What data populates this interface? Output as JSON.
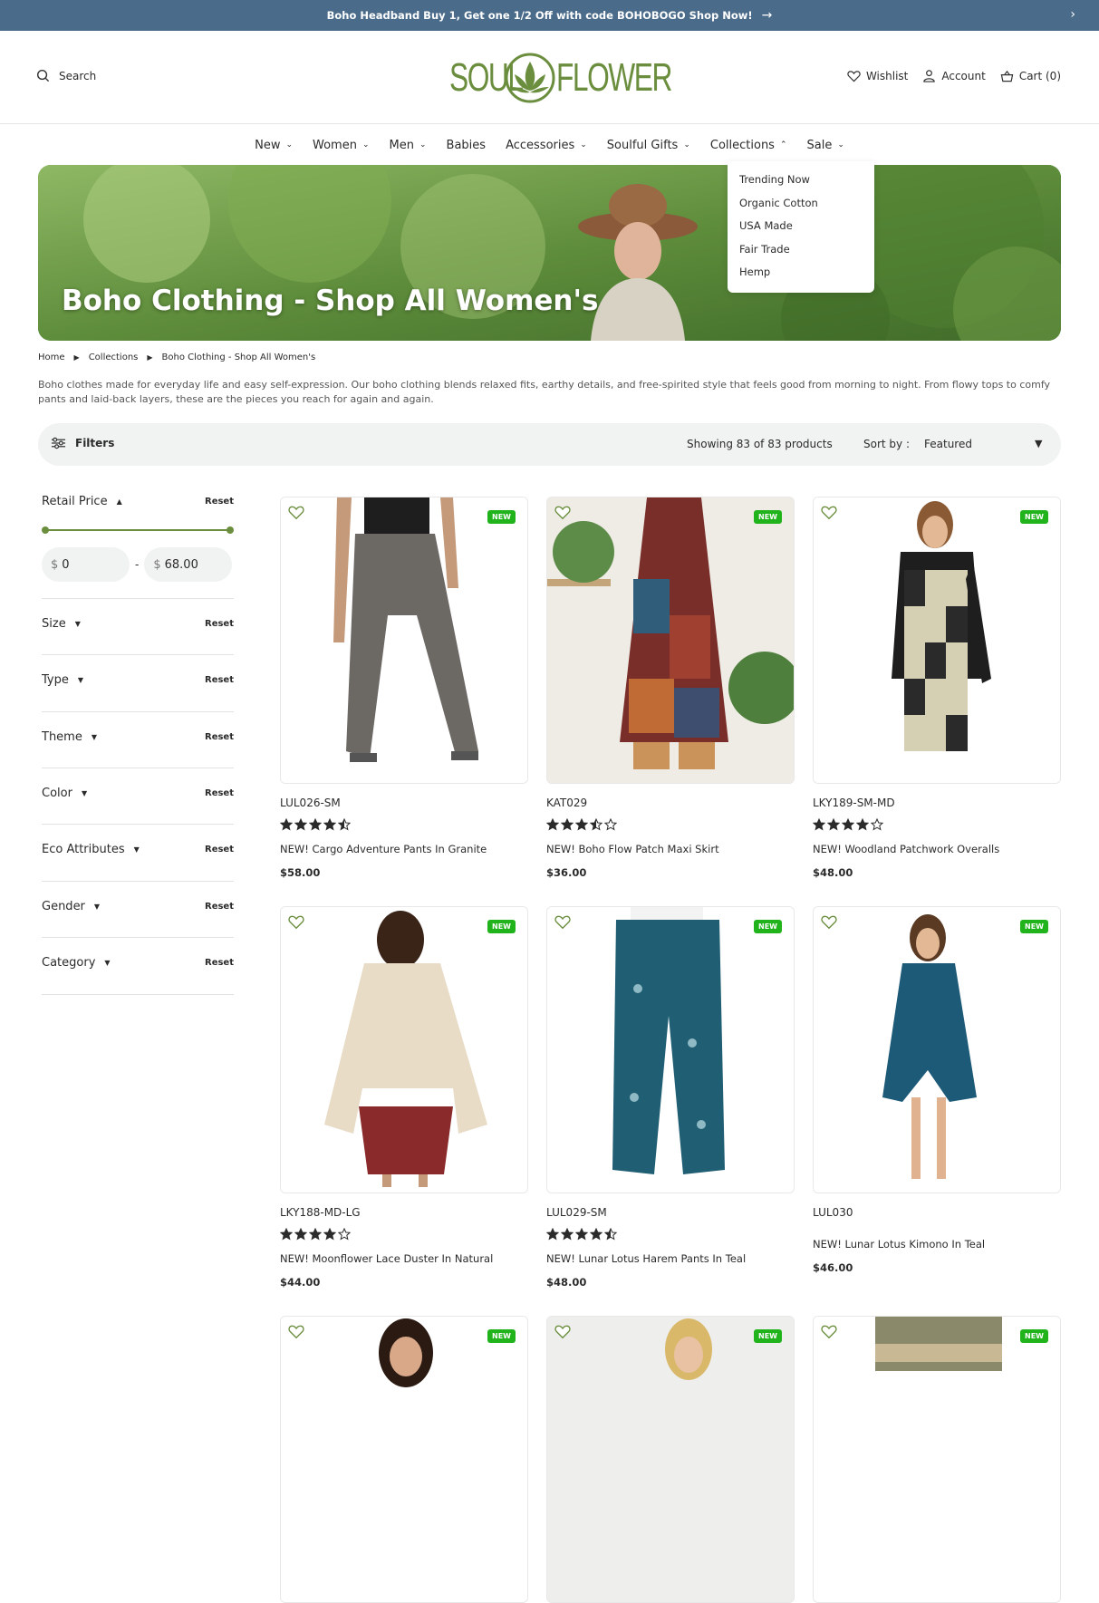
{
  "announcement": {
    "text": "Boho Headband Buy 1, Get one 1/2 Off with code BOHOBOGO  Shop Now!"
  },
  "header": {
    "search_label": "Search",
    "logo": {
      "left": "SOUL",
      "right": "FLOWER",
      "color": "#6b8e3e"
    },
    "wishlist": "Wishlist",
    "account": "Account",
    "cart": "Cart (0)"
  },
  "nav": [
    {
      "label": "New",
      "chevron": true
    },
    {
      "label": "Women",
      "chevron": true
    },
    {
      "label": "Men",
      "chevron": true
    },
    {
      "label": "Babies",
      "chevron": false
    },
    {
      "label": "Accessories",
      "chevron": true
    },
    {
      "label": "Soulful Gifts",
      "chevron": true
    },
    {
      "label": "Collections",
      "chevron": true,
      "open": true
    },
    {
      "label": "Sale",
      "chevron": true
    }
  ],
  "collections_menu": [
    "Trending Now",
    "Organic Cotton",
    "USA Made",
    "Fair Trade",
    "Hemp"
  ],
  "hero": {
    "title": "Boho Clothing - Shop All Women's"
  },
  "breadcrumb": [
    "Home",
    "Collections",
    "Boho Clothing - Shop All Women's"
  ],
  "description": "Boho clothes made for everyday life and easy self-expression. Our boho clothing blends relaxed fits, earthy details, and free-spirited style that feels good from morning to night. From flowy tops to comfy pants and laid-back layers, these are the pieces you reach for again and again.",
  "toolbar": {
    "filters_label": "Filters",
    "showing": "Showing 83 of 83 products",
    "sort_label": "Sort by :",
    "sort_value": "Featured"
  },
  "filters": {
    "price": {
      "label": "Retail Price",
      "reset": "Reset",
      "min": "0",
      "max": "68.00",
      "currency": "$"
    },
    "sections": [
      {
        "label": "Size",
        "reset": "Reset"
      },
      {
        "label": "Type",
        "reset": "Reset"
      },
      {
        "label": "Theme",
        "reset": "Reset"
      },
      {
        "label": "Color",
        "reset": "Reset"
      },
      {
        "label": "Eco Attributes",
        "reset": "Reset"
      },
      {
        "label": "Gender",
        "reset": "Reset"
      },
      {
        "label": "Category",
        "reset": "Reset"
      }
    ]
  },
  "products": [
    {
      "sku": "LUL026-SM",
      "rating": 4.5,
      "name": "NEW! Cargo Adventure Pants In Granite",
      "price": "$58.00",
      "badge": "NEW"
    },
    {
      "sku": "KAT029",
      "rating": 3.5,
      "name": "NEW! Boho Flow Patch Maxi Skirt",
      "price": "$36.00",
      "badge": "NEW"
    },
    {
      "sku": "LKY189-SM-MD",
      "rating": 4,
      "name": "NEW! Woodland Patchwork Overalls",
      "price": "$48.00",
      "badge": "NEW"
    },
    {
      "sku": "LKY188-MD-LG",
      "rating": 4,
      "name": "NEW! Moonflower Lace Duster In Natural",
      "price": "$44.00",
      "badge": "NEW"
    },
    {
      "sku": "LUL029-SM",
      "rating": 4.5,
      "name": "NEW! Lunar Lotus Harem Pants In Teal",
      "price": "$48.00",
      "badge": "NEW"
    },
    {
      "sku": "LUL030",
      "rating": null,
      "name": "NEW! Lunar Lotus Kimono In Teal",
      "price": "$46.00",
      "badge": "NEW"
    },
    {
      "badge": "NEW"
    },
    {
      "badge": "NEW"
    },
    {
      "badge": "NEW"
    }
  ],
  "colors": {
    "topbar": "#4a6b8a",
    "brand_green": "#6b8e3e",
    "badge_green": "#21b31c"
  }
}
